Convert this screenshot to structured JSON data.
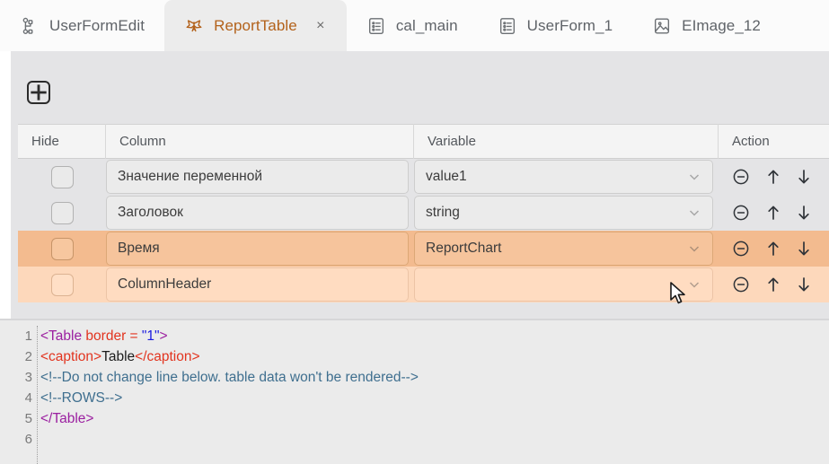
{
  "tabs": [
    {
      "label": "UserFormEdit",
      "icon": "node-hierarchy-icon",
      "active": false,
      "closable": false
    },
    {
      "label": "ReportTable",
      "icon": "butterfly-icon",
      "active": true,
      "closable": true,
      "close_label": "×"
    },
    {
      "label": "cal_main",
      "icon": "form-list-icon",
      "active": false,
      "closable": false
    },
    {
      "label": "UserForm_1",
      "icon": "form-list-icon",
      "active": false,
      "closable": false
    },
    {
      "label": "EImage_12",
      "icon": "image-icon",
      "active": false,
      "closable": false
    }
  ],
  "toolbar": {
    "add_button_label": "+",
    "add_button_icon": "plus-square-icon"
  },
  "table": {
    "headers": [
      "Hide",
      "Column",
      "Variable",
      "Action"
    ],
    "rows": [
      {
        "hide_checked": false,
        "column": "Значение переменной",
        "variable": "value1",
        "highlight": "none"
      },
      {
        "hide_checked": false,
        "column": "Заголовок",
        "variable": "string",
        "highlight": "none"
      },
      {
        "hide_checked": false,
        "column": "Время",
        "variable": "ReportChart",
        "highlight": "dark"
      },
      {
        "hide_checked": false,
        "column": "ColumnHeader",
        "variable": "",
        "highlight": "light"
      }
    ],
    "actions": {
      "remove": "remove-row-icon",
      "move_up": "move-up-icon",
      "move_down": "move-down-icon"
    }
  },
  "editor": {
    "line_numbers": [
      "1",
      "2",
      "3",
      "4",
      "5",
      "6"
    ],
    "lines": [
      [
        {
          "t": "<Table ",
          "c": "tagp"
        },
        {
          "t": "border",
          "c": "attr"
        },
        {
          "t": " = ",
          "c": "attr"
        },
        {
          "t": "\"1\"",
          "c": "val"
        },
        {
          "t": ">",
          "c": "tagp"
        }
      ],
      [
        {
          "t": "<caption>",
          "c": "attr"
        },
        {
          "t": "Table",
          "c": "txt"
        },
        {
          "t": "</caption>",
          "c": "attr"
        }
      ],
      [
        {
          "t": "<!--Do not change line below. table data won't be rendered-->",
          "c": "cmt"
        }
      ],
      [
        {
          "t": "<!--ROWS-->",
          "c": "cmt"
        }
      ],
      [
        {
          "t": "</Table>",
          "c": "tagp"
        }
      ],
      [
        {
          "t": "",
          "c": "txt"
        }
      ]
    ]
  },
  "colors": {
    "active_tab_text": "#b3621b",
    "row_highlight_dark": "#f3bb8f",
    "row_highlight_light": "#fdd8bb",
    "panel_background": "#e4e4e6"
  }
}
